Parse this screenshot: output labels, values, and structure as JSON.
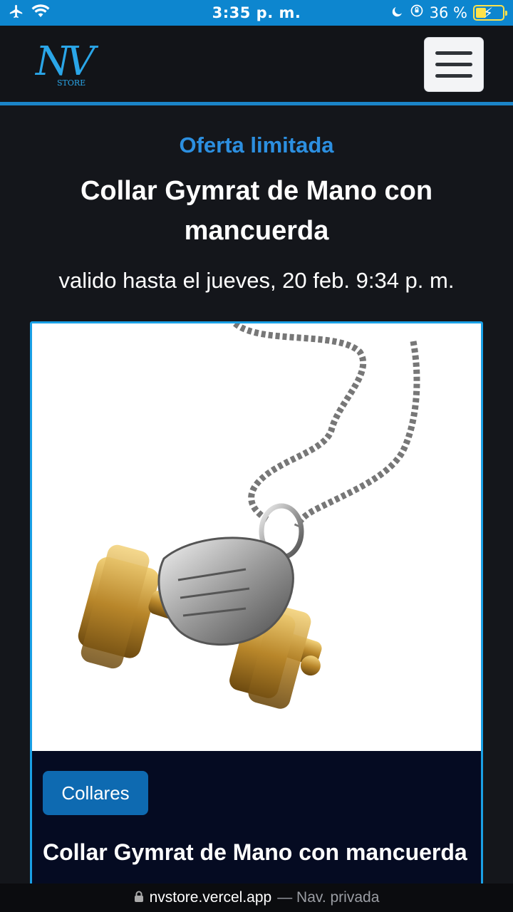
{
  "status_bar": {
    "time": "3:35 p. m.",
    "battery": "36 %",
    "battery_level": 0.36,
    "icons": [
      "airplane-icon",
      "wifi-icon",
      "moon-icon",
      "orientation-lock-icon",
      "battery-icon"
    ]
  },
  "header": {
    "logo_text": "NV",
    "logo_subtext": "STORE",
    "menu_icon": "hamburger-menu-icon"
  },
  "hero": {
    "offer_label": "Oferta limitada",
    "title": "Collar Gymrat de Mano con mancuerda",
    "valid_until": "valido hasta el jueves, 20 feb. 9:34 p. m."
  },
  "card": {
    "category": "Collares",
    "title": "Collar Gymrat de Mano con mancuerda"
  },
  "browser": {
    "url": "nvstore.vercel.app",
    "mode": "— Nav. privada"
  },
  "colors": {
    "accent": "#1b84c8",
    "status_bar": "#0d86cf",
    "background": "#14161b",
    "card_bg": "#050b22",
    "badge": "#0e6ab1"
  }
}
